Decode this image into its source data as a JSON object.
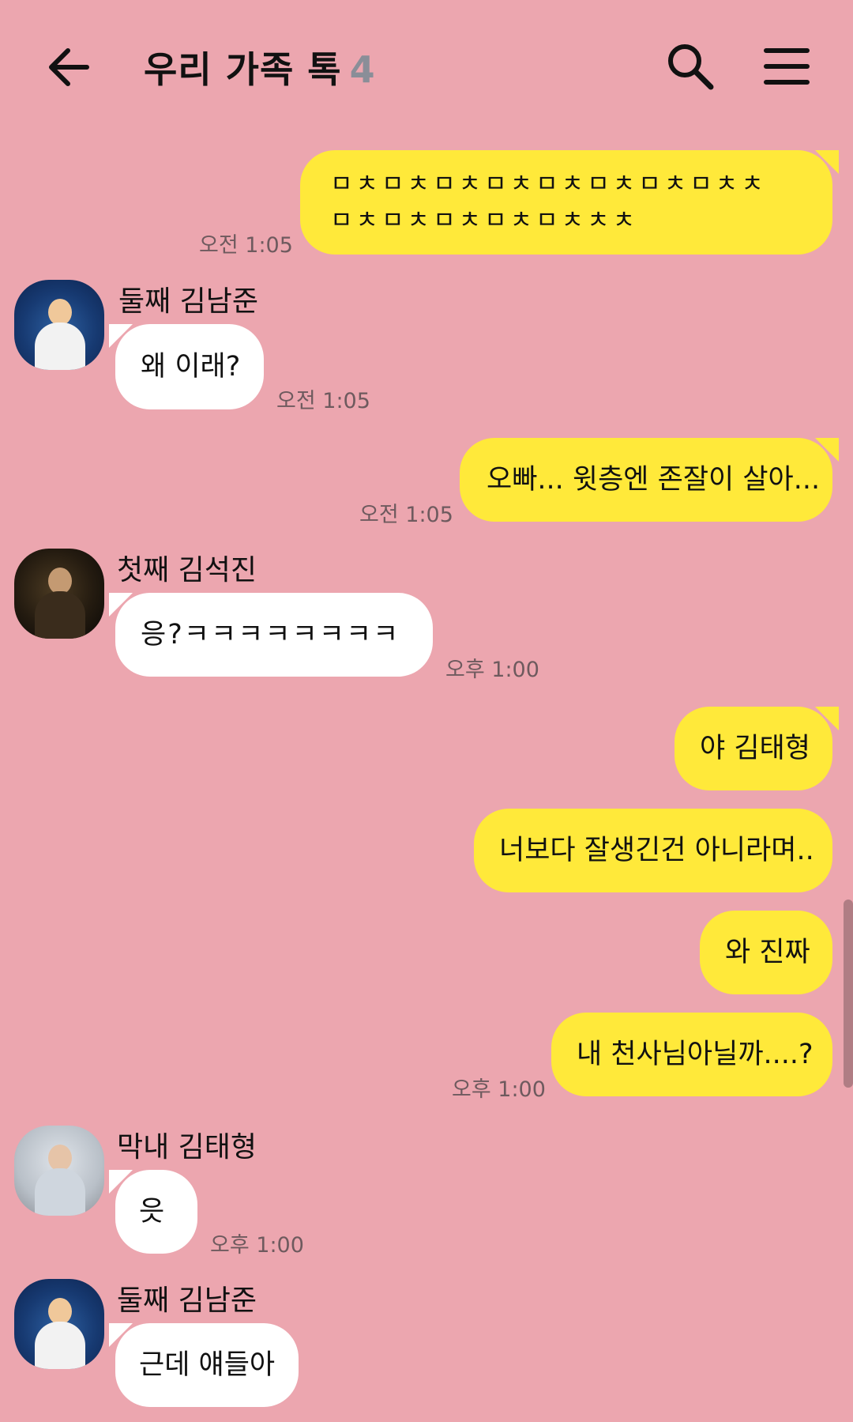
{
  "header": {
    "title": "우리 가족 톡",
    "member_count": "4",
    "back_icon": "arrow-left-icon",
    "search_icon": "search-icon",
    "menu_icon": "hamburger-menu-icon"
  },
  "messages": [
    {
      "from": "me",
      "text_line1": "ㅁㅊㅁㅊㅁㅊㅁㅊㅁㅊㅁㅊㅁㅊㅁㅊㅊ",
      "text_line2": "ㅁㅊㅁㅊㅁㅊㅁㅊㅁㅊㅊㅊ",
      "time": "오전 1:05"
    },
    {
      "from": "other",
      "sender": "둘째 김남준",
      "text": "왜 이래?",
      "time": "오전 1:05"
    },
    {
      "from": "me",
      "text": "오빠... 윗층엔 존잘이 살아...",
      "time": "오전 1:05"
    },
    {
      "from": "other",
      "sender": "첫째 김석진",
      "text": "응?ㅋㅋㅋㅋㅋㅋㅋㅋ",
      "time": "오후 1:00"
    },
    {
      "from": "me",
      "text": "야 김태형"
    },
    {
      "from": "me",
      "text": "너보다 잘생긴건 아니라며.."
    },
    {
      "from": "me",
      "text": "와 진짜"
    },
    {
      "from": "me",
      "text": "내 천사님아닐까....?",
      "time": "오후 1:00"
    },
    {
      "from": "other",
      "sender": "막내 김태형",
      "text": "읏",
      "time": "오후 1:00"
    },
    {
      "from": "other",
      "sender": "둘째 김남준",
      "text": "근데 얘들아"
    }
  ],
  "colors": {
    "background": "#eca6af",
    "my_bubble": "#ffe93a",
    "other_bubble": "#ffffff",
    "time_text": "#6e5a5e",
    "member_count": "#8a8e98"
  }
}
